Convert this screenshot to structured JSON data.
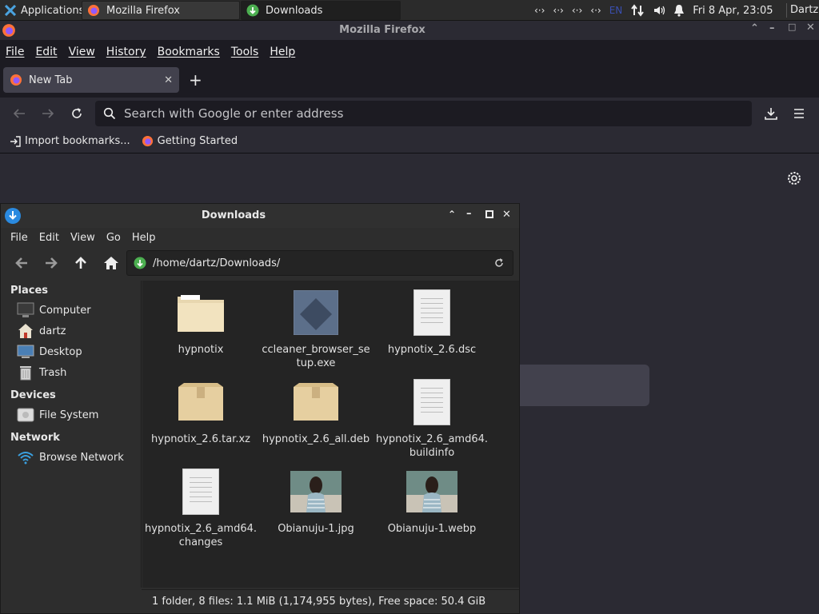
{
  "panel": {
    "apps_label": "Applications",
    "tasks": [
      {
        "label": "Mozilla Firefox"
      },
      {
        "label": "Downloads"
      }
    ],
    "net_glyph": "‹·›",
    "lang": "EN",
    "datetime": "Fri  8 Apr, 23:05",
    "user": "Dartz"
  },
  "firefox": {
    "window_title": "Mozilla Firefox",
    "menu": [
      "File",
      "Edit",
      "View",
      "History",
      "Bookmarks",
      "Tools",
      "Help"
    ],
    "tab_label": "New Tab",
    "url_placeholder": "Search with Google or enter address",
    "bookmarks": [
      {
        "label": "Import bookmarks..."
      },
      {
        "label": "Getting Started"
      }
    ]
  },
  "filemanager": {
    "title": "Downloads",
    "menu": [
      "File",
      "Edit",
      "View",
      "Go",
      "Help"
    ],
    "path": "/home/dartz/Downloads/",
    "places_heading": "Places",
    "places": [
      "Computer",
      "dartz",
      "Desktop",
      "Trash"
    ],
    "devices_heading": "Devices",
    "devices": [
      "File System"
    ],
    "network_heading": "Network",
    "network": [
      "Browse Network"
    ],
    "files": [
      {
        "name": "hypnotix",
        "type": "folder"
      },
      {
        "name": "ccleaner_browser_setup.exe",
        "type": "exe"
      },
      {
        "name": "hypnotix_2.6.dsc",
        "type": "doc"
      },
      {
        "name": "hypnotix_2.6.tar.xz",
        "type": "archive"
      },
      {
        "name": "hypnotix_2.6_all.deb",
        "type": "archive"
      },
      {
        "name": "hypnotix_2.6_amd64.buildinfo",
        "type": "doc"
      },
      {
        "name": "hypnotix_2.6_amd64.changes",
        "type": "doc"
      },
      {
        "name": "Obianuju-1.jpg",
        "type": "image"
      },
      {
        "name": "Obianuju-1.webp",
        "type": "image"
      }
    ],
    "status": "1 folder, 8 files: 1.1 MiB (1,174,955 bytes), Free space: 50.4 GiB"
  }
}
